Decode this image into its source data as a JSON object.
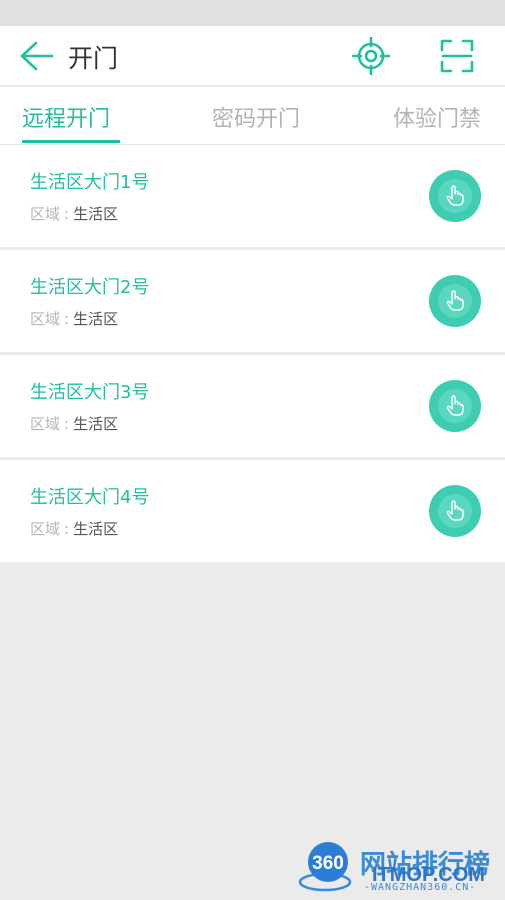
{
  "header": {
    "title": "开门",
    "back_icon": "arrow-left-icon",
    "locate_icon": "crosshair-icon",
    "scan_icon": "scan-frame-icon"
  },
  "tabs": [
    {
      "label": "远程开门",
      "active": true
    },
    {
      "label": "密码开门",
      "active": false
    },
    {
      "label": "体验门禁",
      "active": false
    }
  ],
  "doors": [
    {
      "name": "生活区大门1号",
      "area_label": "区域",
      "area_sep": ":",
      "area": "生活区",
      "action_icon": "tap-finger-icon"
    },
    {
      "name": "生活区大门2号",
      "area_label": "区域",
      "area_sep": ":",
      "area": "生活区",
      "action_icon": "tap-finger-icon"
    },
    {
      "name": "生活区大门3号",
      "area_label": "区域",
      "area_sep": ":",
      "area": "生活区",
      "action_icon": "tap-finger-icon"
    },
    {
      "name": "生活区大门4号",
      "area_label": "区域",
      "area_sep": ":",
      "area": "生活区",
      "action_icon": "tap-finger-icon"
    }
  ],
  "watermark": {
    "logo_text": "360",
    "brand": "网站排行榜",
    "brand_overlay": "ITMOP.COM",
    "sub": "-WANGZHAN360.CN-"
  },
  "colors": {
    "accent": "#1fbf9f",
    "button": "#3ecdb0",
    "background": "#ebebeb"
  }
}
